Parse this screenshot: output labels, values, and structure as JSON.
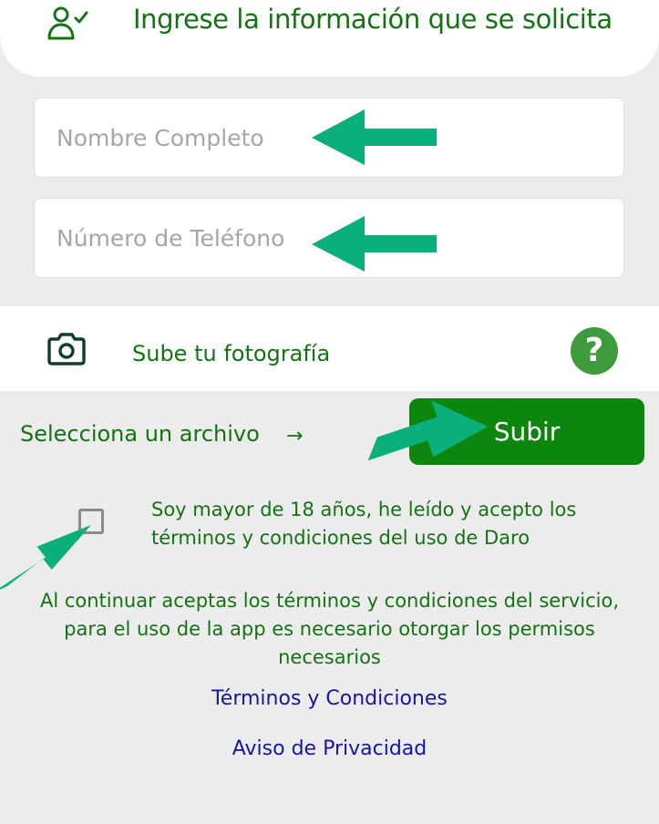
{
  "header": {
    "title": "Ingrese la información que se solicita",
    "icon": "user-check-icon"
  },
  "form": {
    "name_placeholder": "Nombre Completo",
    "name_value": "",
    "phone_placeholder": "Número de Teléfono",
    "phone_value": ""
  },
  "photo": {
    "label": "Sube tu fotografía",
    "icon": "camera-icon",
    "help_symbol": "?"
  },
  "upload": {
    "select_label": "Selecciona un archivo",
    "arrow": "→",
    "button_label": "Subir"
  },
  "consent": {
    "text": "Soy mayor de 18 años, he leído y acepto los términos y condiciones del uso de Daro",
    "checked": false
  },
  "notice": "Al continuar aceptas los términos y condiciones del servicio, para el uso de la app es necesario otorgar los permisos necesarios",
  "links": {
    "terms": "Términos y Condiciones",
    "privacy": "Aviso de Privacidad"
  },
  "colors": {
    "brand_green": "#137313",
    "button_green": "#0d860d",
    "annotation_arrow": "#0aaf7c",
    "link_blue": "#1616a6",
    "background": "#ececec"
  }
}
